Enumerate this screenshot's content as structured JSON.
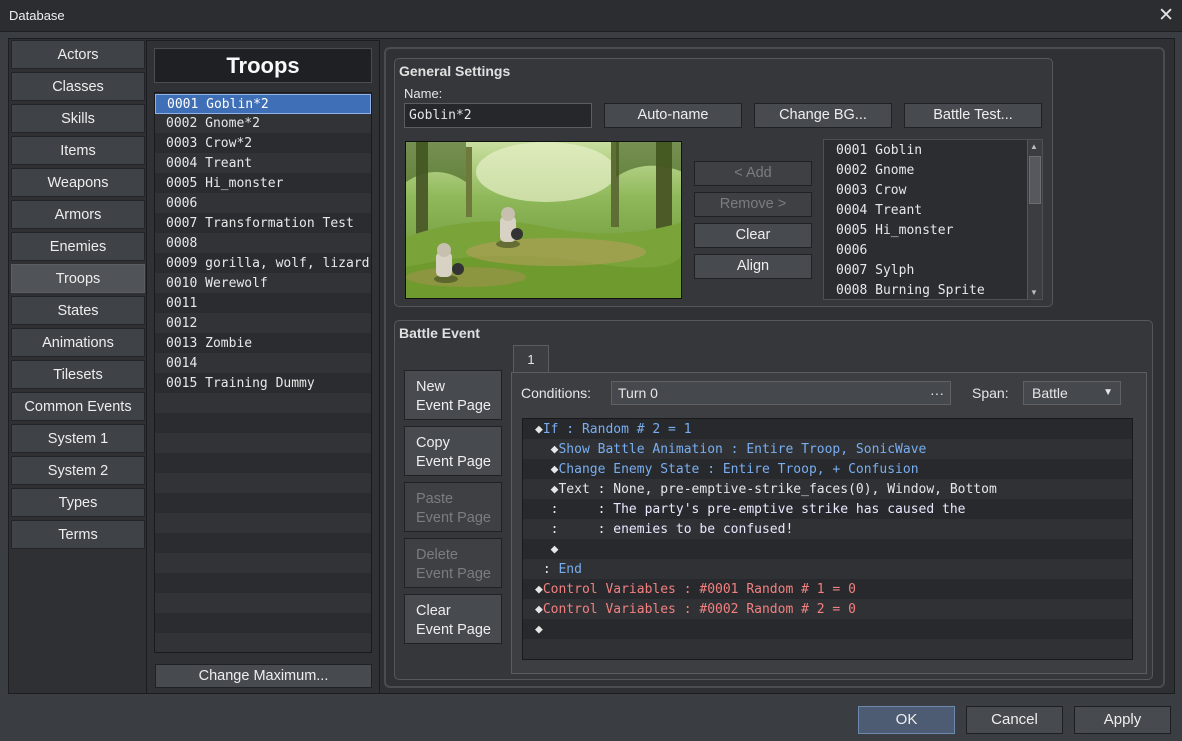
{
  "window": {
    "title": "Database",
    "close_glyph": "✕"
  },
  "categories": [
    {
      "label": "Actors"
    },
    {
      "label": "Classes"
    },
    {
      "label": "Skills"
    },
    {
      "label": "Items"
    },
    {
      "label": "Weapons"
    },
    {
      "label": "Armors"
    },
    {
      "label": "Enemies"
    },
    {
      "label": "Troops",
      "selected": true
    },
    {
      "label": "States"
    },
    {
      "label": "Animations"
    },
    {
      "label": "Tilesets"
    },
    {
      "label": "Common Events"
    },
    {
      "label": "System 1"
    },
    {
      "label": "System 2"
    },
    {
      "label": "Types"
    },
    {
      "label": "Terms"
    }
  ],
  "troops": {
    "header": "Troops",
    "items": [
      "0001 Goblin*2",
      "0002 Gnome*2",
      "0003 Crow*2",
      "0004 Treant",
      "0005 Hi_monster",
      "0006 ",
      "0007 Transformation Test",
      "0008 ",
      "0009 gorilla, wolf, lizard",
      "0010 Werewolf",
      "0011 ",
      "0012 ",
      "0013 Zombie",
      "0014 ",
      "0015 Training Dummy"
    ],
    "change_max_label": "Change Maximum..."
  },
  "general": {
    "title": "General Settings",
    "name_label": "Name:",
    "name_value": "Goblin*2",
    "auto_name": "Auto-name",
    "change_bg": "Change BG...",
    "battle_test": "Battle Test...",
    "add": "< Add",
    "remove": "Remove >",
    "clear": "Clear",
    "align": "Align",
    "enemies": [
      "0001 Goblin",
      "0002 Gnome",
      "0003 Crow",
      "0004 Treant",
      "0005 Hi_monster",
      "0006 ",
      "0007 Sylph",
      "0008 Burning Sprite"
    ]
  },
  "battle_event": {
    "title": "Battle Event",
    "tab": "1",
    "new_page": [
      "New",
      "Event Page"
    ],
    "copy_page": [
      "Copy",
      "Event Page"
    ],
    "paste_page": [
      "Paste",
      "Event Page"
    ],
    "delete_page": [
      "Delete",
      "Event Page"
    ],
    "clear_page": [
      "Clear",
      "Event Page"
    ],
    "conditions_label": "Conditions:",
    "conditions_value": "Turn 0",
    "conditions_more": "···",
    "span_label": "Span:",
    "span_value": "Battle",
    "commands": [
      {
        "indent": "◆",
        "a": "If",
        "b": " : Random # 2 = 1",
        "color": "blue"
      },
      {
        "indent": "  ◆",
        "a": "Show Battle Animation",
        "b": " : Entire Troop, SonicWave",
        "color": "blue"
      },
      {
        "indent": "  ◆",
        "a": "Change Enemy State",
        "b": " : Entire Troop, + Confusion",
        "color": "blue"
      },
      {
        "indent": "  ◆",
        "a": "Text",
        "b": " : None, pre-emptive-strike_faces(0), Window, Bottom",
        "color": "plain"
      },
      {
        "indent": "  :     ",
        "a": "",
        "b": ": The party's pre-emptive strike has caused the",
        "color": "plain2"
      },
      {
        "indent": "  :     ",
        "a": "",
        "b": ": enemies to be confused!",
        "color": "plain2"
      },
      {
        "indent": "  ◆",
        "a": "",
        "b": "",
        "color": "plain"
      },
      {
        "indent": " : ",
        "a": "End",
        "b": "",
        "color": "blue"
      },
      {
        "indent": "◆",
        "a": "Control Variables",
        "b": " : #0001 Random # 1 = 0",
        "color": "red"
      },
      {
        "indent": "◆",
        "a": "Control Variables",
        "b": " : #0002 Random # 2 = 0",
        "color": "red"
      },
      {
        "indent": "◆",
        "a": "",
        "b": "",
        "color": "plain"
      }
    ]
  },
  "footer": {
    "ok": "OK",
    "cancel": "Cancel",
    "apply": "Apply"
  }
}
